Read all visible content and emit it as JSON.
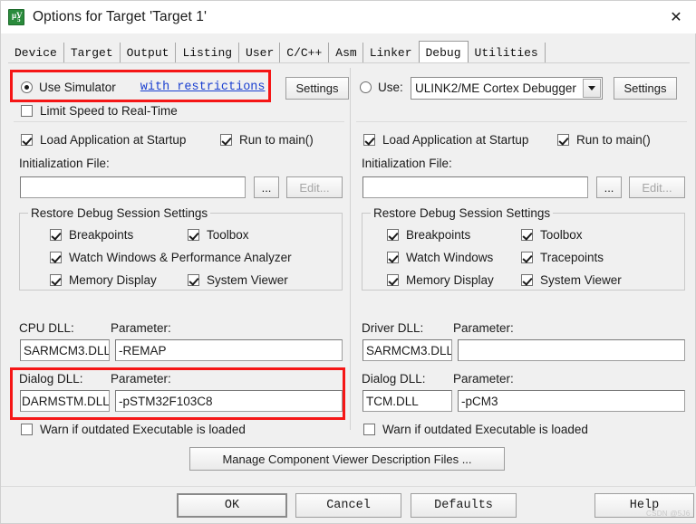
{
  "window": {
    "title": "Options for Target 'Target 1'",
    "icon": "uvision-logo-icon",
    "close_label": "✕",
    "logo_glyph_top": "μV",
    "logo_glyph_bottom": "5"
  },
  "tabs": [
    {
      "label": "Device",
      "selected": false
    },
    {
      "label": "Target",
      "selected": false
    },
    {
      "label": "Output",
      "selected": false
    },
    {
      "label": "Listing",
      "selected": false
    },
    {
      "label": "User",
      "selected": false
    },
    {
      "label": "C/C++",
      "selected": false
    },
    {
      "label": "Asm",
      "selected": false
    },
    {
      "label": "Linker",
      "selected": false
    },
    {
      "label": "Debug",
      "selected": true
    },
    {
      "label": "Utilities",
      "selected": false
    }
  ],
  "left": {
    "use_simulator_label": "Use Simulator",
    "use_simulator_checked": true,
    "with_restrictions_link": "with restrictions",
    "settings_label": "Settings",
    "limit_speed_label": "Limit Speed to Real-Time",
    "limit_speed_checked": false,
    "load_app_label": "Load Application at Startup",
    "load_app_checked": true,
    "run_to_main_label": "Run to main()",
    "run_to_main_checked": true,
    "init_file_label": "Initialization File:",
    "init_file_value": "",
    "browse_label": "...",
    "edit_label": "Edit...",
    "group_title": "Restore Debug Session Settings",
    "restore": [
      {
        "label": "Breakpoints",
        "checked": true
      },
      {
        "label": "Toolbox",
        "checked": true
      },
      {
        "label": "Watch Windows & Performance Analyzer",
        "checked": true
      },
      {
        "label": "Memory Display",
        "checked": true
      },
      {
        "label": "System Viewer",
        "checked": true
      }
    ],
    "cpu_dll_label": "CPU DLL:",
    "cpu_dll_value": "SARMCM3.DLL",
    "cpu_param_label": "Parameter:",
    "cpu_param_value": "-REMAP",
    "dialog_dll_label": "Dialog DLL:",
    "dialog_dll_value": "DARMSTM.DLL",
    "dialog_param_label": "Parameter:",
    "dialog_param_value": "-pSTM32F103C8",
    "warn_label": "Warn if outdated Executable is loaded",
    "warn_checked": false
  },
  "right": {
    "use_label": "Use:",
    "use_checked": false,
    "debugger_selected": "ULINK2/ME Cortex Debugger",
    "settings_label": "Settings",
    "load_app_label": "Load Application at Startup",
    "load_app_checked": true,
    "run_to_main_label": "Run to main()",
    "run_to_main_checked": true,
    "init_file_label": "Initialization File:",
    "init_file_value": "",
    "browse_label": "...",
    "edit_label": "Edit...",
    "group_title": "Restore Debug Session Settings",
    "restore": [
      {
        "label": "Breakpoints",
        "checked": true
      },
      {
        "label": "Toolbox",
        "checked": true
      },
      {
        "label": "Watch Windows",
        "checked": true
      },
      {
        "label": "Tracepoints",
        "checked": true
      },
      {
        "label": "Memory Display",
        "checked": true
      },
      {
        "label": "System Viewer",
        "checked": true
      }
    ],
    "driver_dll_label": "Driver DLL:",
    "driver_dll_value": "SARMCM3.DLL",
    "driver_param_label": "Parameter:",
    "driver_param_value": "",
    "dialog_dll_label": "Dialog DLL:",
    "dialog_dll_value": "TCM.DLL",
    "dialog_param_label": "Parameter:",
    "dialog_param_value": "-pCM3",
    "warn_label": "Warn if outdated Executable is loaded",
    "warn_checked": false
  },
  "manage_button_label": "Manage Component Viewer Description Files ...",
  "footer": {
    "ok": "OK",
    "cancel": "Cancel",
    "defaults": "Defaults",
    "help": "Help"
  },
  "annotations": {
    "highlight_color": "#f51616",
    "boxes": 2
  },
  "watermark": "CSDN @5J6"
}
